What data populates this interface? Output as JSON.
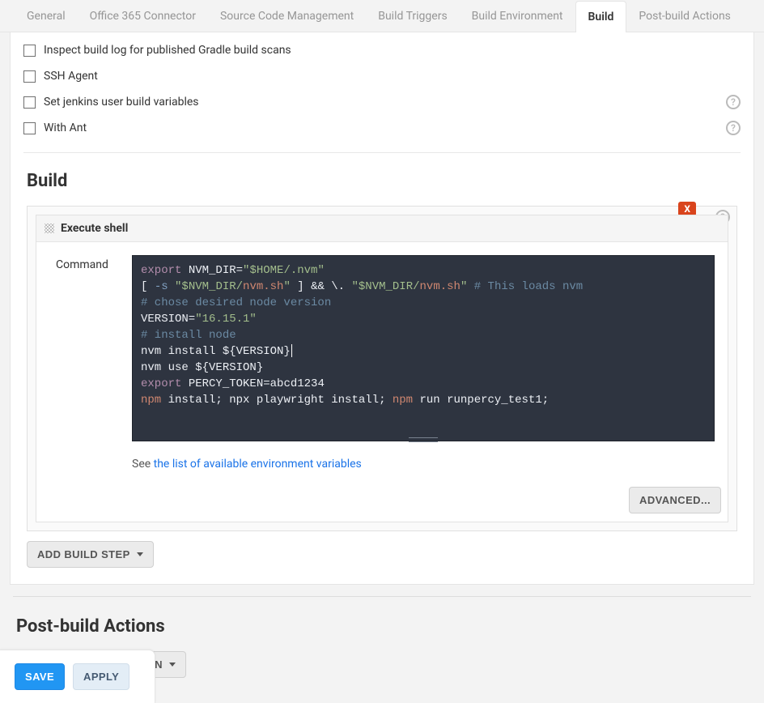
{
  "tabs": [
    {
      "label": "General"
    },
    {
      "label": "Office 365 Connector"
    },
    {
      "label": "Source Code Management"
    },
    {
      "label": "Build Triggers"
    },
    {
      "label": "Build Environment"
    },
    {
      "label": "Build",
      "active": true
    },
    {
      "label": "Post-build Actions"
    }
  ],
  "buildEnvironment": {
    "options": [
      {
        "label": "Inspect build log for published Gradle build scans"
      },
      {
        "label": "SSH Agent"
      },
      {
        "label": "Set jenkins user build variables",
        "help": true
      },
      {
        "label": "With Ant",
        "help": true
      }
    ]
  },
  "build": {
    "title": "Build",
    "close_label": "X",
    "step": {
      "title": "Execute shell",
      "command_label": "Command",
      "code": {
        "line1": {
          "kw": "export",
          "text": " NVM_DIR=",
          "str": "\"$HOME/.nvm\""
        },
        "line2": {
          "p1": "[ ",
          "op1": "-s ",
          "s1": "\"$NVM_DIR/",
          "o1": "nvm.sh",
          "s1b": "\"",
          "p2": " ] && \\. ",
          "s2": "\"$NVM_DIR/",
          "o2": "nvm.sh",
          "s2b": "\"",
          "cmt": "  # This loads nvm"
        },
        "line3_cmt": "# chose desired node version",
        "line4": {
          "t1": "VERSION=",
          "str": "\"16.15.1\""
        },
        "line5_cmt": "# install node",
        "line6": "nvm install ${VERSION}",
        "line7": "nvm use ${VERSION}",
        "line8": {
          "kw": "export",
          "text": " PERCY_TOKEN=abcd1234"
        },
        "line9": {
          "c1": "npm",
          "t1": " install; npx playwright install; ",
          "c2": "npm",
          "t2": " run runpercy_test1;"
        }
      },
      "hint_prefix": "See ",
      "hint_link": "the list of available environment variables",
      "advanced_label": "ADVANCED..."
    },
    "add_step_label": "ADD BUILD STEP"
  },
  "postBuild": {
    "title": "Post-build Actions",
    "add_label": "ADD POST-BUILD ACTION"
  },
  "footer": {
    "save": "SAVE",
    "apply": "APPLY"
  },
  "help_glyph": "?"
}
